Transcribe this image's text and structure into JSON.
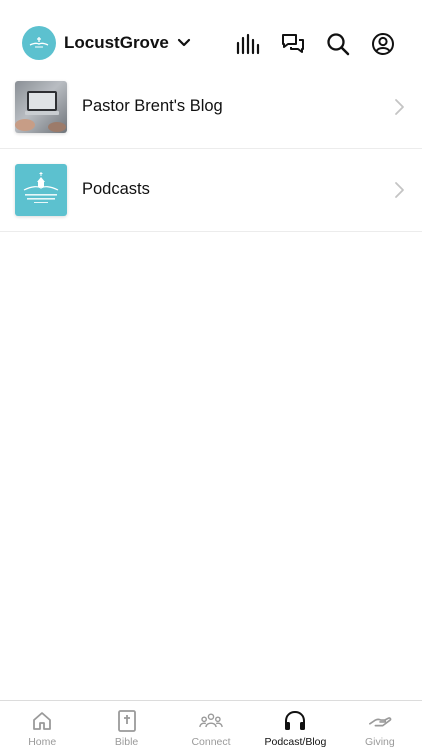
{
  "header": {
    "church_name": "LocustGrove"
  },
  "list": {
    "items": [
      {
        "label": "Pastor Brent's Blog"
      },
      {
        "label": "Podcasts"
      }
    ]
  },
  "tabs": [
    {
      "label": "Home",
      "icon": "home-icon",
      "active": false
    },
    {
      "label": "Bible",
      "icon": "bible-icon",
      "active": false
    },
    {
      "label": "Connect",
      "icon": "people-icon",
      "active": false
    },
    {
      "label": "Podcast/Blog",
      "icon": "headphones-icon",
      "active": true
    },
    {
      "label": "Giving",
      "icon": "giving-hand-icon",
      "active": false
    }
  ],
  "colors": {
    "brand": "#5cc1cf",
    "inactive_tab": "#9a9a9a",
    "active_tab": "#111111"
  }
}
